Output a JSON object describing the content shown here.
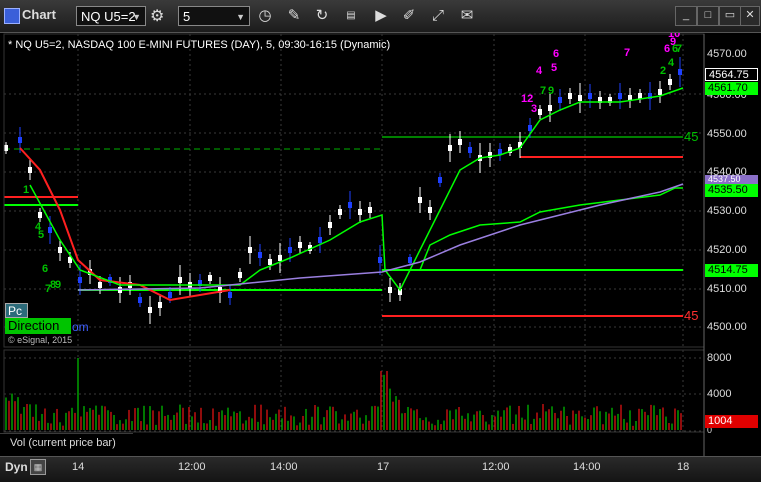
{
  "window": {
    "title": "Chart",
    "symbol": "NQ U5=2",
    "interval": "5",
    "toolbar_icons": [
      "clock-icon",
      "pencil-icon",
      "refresh-icon",
      "study-icon",
      "play-icon",
      "link-icon",
      "chat-icon"
    ],
    "window_controls": [
      "minimize-icon",
      "maximize-icon",
      "close-icon"
    ]
  },
  "chart": {
    "status_line": "* NQ U5=2, NASDAQ 100 E-MINI FUTURES (DAY), 5, 09:30-16:15 (Dynamic)",
    "price_labels": [
      "4570.00",
      "4560.00",
      "4550.00",
      "4540.00",
      "4530.00",
      "4520.00",
      "4510.00",
      "4500.00"
    ],
    "price_tags": [
      {
        "text": "4564.75",
        "bg": "#000000",
        "fg": "#ffffff",
        "border": "#ffffff"
      },
      {
        "text": "4561.70",
        "bg": "#00ff00",
        "fg": "#000000"
      },
      {
        "text": "4537.50",
        "bg": "#8a6fc8",
        "fg": "#ffffff"
      },
      {
        "text": "4535.50",
        "bg": "#00ff00",
        "fg": "#000000"
      },
      {
        "text": "4514.75",
        "bg": "#00ff00",
        "fg": "#000000"
      }
    ],
    "level_labels": [
      {
        "text": "45",
        "color": "#00c000"
      },
      {
        "text": "45",
        "color": "#ff3030"
      }
    ],
    "pc_label": "Pc",
    "direction_label": "Direction",
    "direction_suffix": "om",
    "copyright": "© eSignal, 2015",
    "counts": [
      {
        "text": "10",
        "color": "#ff00ff"
      },
      {
        "text": "9",
        "color": "#ff00ff"
      },
      {
        "text": "6",
        "color": "#ff00ff"
      },
      {
        "text": "7",
        "color": "#ff00ff"
      },
      {
        "text": "6",
        "color": "#ff00ff"
      },
      {
        "text": "5",
        "color": "#ff00ff"
      },
      {
        "text": "4",
        "color": "#ff00ff"
      },
      {
        "text": "3",
        "color": "#ff00ff"
      },
      {
        "text": "12",
        "color": "#ff00ff"
      },
      {
        "text": "1",
        "color": "#00c000"
      },
      {
        "text": "4",
        "color": "#00c000"
      },
      {
        "text": "5",
        "color": "#00c000"
      },
      {
        "text": "6",
        "color": "#00c000"
      },
      {
        "text": "7",
        "color": "#00c000"
      },
      {
        "text": "8",
        "color": "#00c000"
      },
      {
        "text": "9",
        "color": "#00c000"
      },
      {
        "text": "6",
        "color": "#00c000"
      },
      {
        "text": "7",
        "color": "#00c000"
      },
      {
        "text": "4",
        "color": "#00c000"
      },
      {
        "text": "2",
        "color": "#00c000"
      },
      {
        "text": "7",
        "color": "#00c000"
      },
      {
        "text": "9",
        "color": "#00c000"
      }
    ]
  },
  "volume": {
    "label": "Vol (current price bar)",
    "scale_labels": [
      "8000",
      "4000",
      "0"
    ],
    "current_tag": "1004"
  },
  "time_axis": {
    "labels": [
      "14",
      "12:00",
      "14:00",
      "17",
      "12:00",
      "14:00",
      "18"
    ],
    "dyn_label": "Dyn"
  },
  "colors": {
    "up_bar": "#ffffff",
    "down_bar": "#1e40ff",
    "ma_green": "#00ff00",
    "ma_purple": "#9a7fe0",
    "level_red": "#ff2020",
    "level_green": "#00ff00"
  }
}
